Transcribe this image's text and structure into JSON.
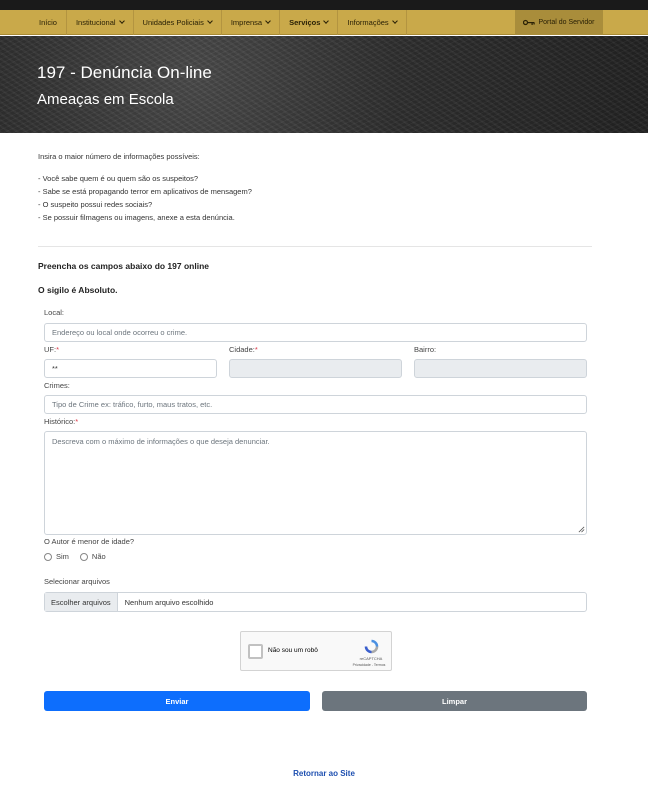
{
  "nav": {
    "items": [
      {
        "label": "Início",
        "has_dropdown": false,
        "bold": false
      },
      {
        "label": "Institucional",
        "has_dropdown": true,
        "bold": false
      },
      {
        "label": "Unidades Policiais",
        "has_dropdown": true,
        "bold": false
      },
      {
        "label": "Imprensa",
        "has_dropdown": true,
        "bold": false
      },
      {
        "label": "Serviços",
        "has_dropdown": true,
        "bold": true
      },
      {
        "label": "Informações",
        "has_dropdown": true,
        "bold": false
      }
    ],
    "portal_label": "Portal do Servidor",
    "portal_icon": "key-icon"
  },
  "hero": {
    "title": "197 - Denúncia On-line",
    "subtitle": "Ameaças em Escola"
  },
  "intro": {
    "lead": "Insira o maior número de informações possíveis:",
    "bullets": [
      "- Você sabe quem é ou quem são os suspeitos?",
      "- Sabe se está propagando terror em aplicativos de mensagem?",
      "- O suspeito possui redes sociais?",
      "- Se possuir filmagens ou imagens, anexe a esta denúncia."
    ]
  },
  "form": {
    "heading": "Preencha os campos abaixo do 197 online",
    "sigilo": "O sigilo é Absoluto.",
    "local_label": "Local:",
    "local_placeholder": "Endereço ou local onde ocorreu o crime.",
    "uf_label": "UF:",
    "uf_value": "**",
    "cidade_label": "Cidade:",
    "bairro_label": "Bairro:",
    "required_mark": "*",
    "crimes_label": "Crimes:",
    "crimes_placeholder": "Tipo de Crime ex: tráfico, furto, maus tratos, etc.",
    "historico_label": "Histórico:",
    "historico_placeholder": "Descreva com o máximo de informações o que deseja denunciar.",
    "menor_label": "O Autor é menor de idade?",
    "menor_options": [
      "Sim",
      "Não"
    ],
    "arquivos_label": "Selecionar arquivos",
    "file_button": "Escolher arquivos",
    "file_status": "Nenhum arquivo escolhido",
    "captcha_text": "Não sou um robô",
    "captcha_brand": "reCAPTCHA",
    "captcha_links": "Privacidade - Termos",
    "submit_label": "Enviar",
    "clear_label": "Limpar"
  },
  "footer": {
    "back_link": "Retornar ao Site"
  },
  "colors": {
    "nav_bg": "#c9a94a",
    "primary": "#0d6efd",
    "secondary": "#6c757d",
    "required": "#dc3545",
    "link": "#1d4fb0"
  }
}
